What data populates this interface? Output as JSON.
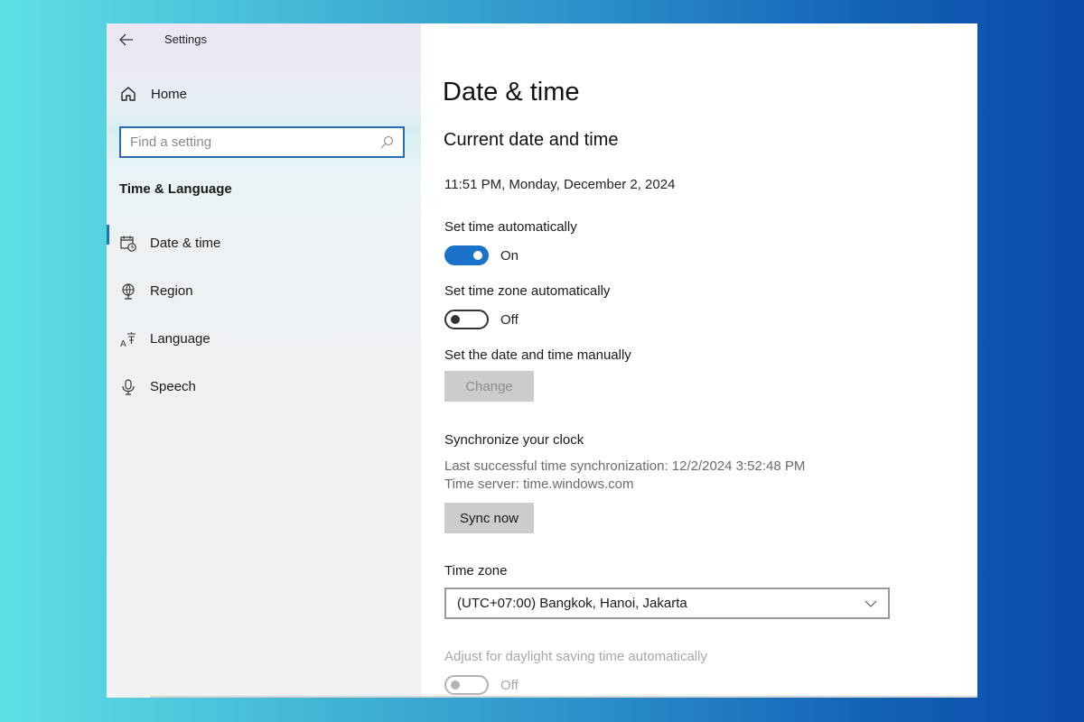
{
  "window": {
    "title": "Settings",
    "back_icon": "arrow-left-icon"
  },
  "sidebar": {
    "home_label": "Home",
    "home_icon": "home-icon",
    "search": {
      "placeholder": "Find a setting",
      "value": "",
      "icon": "search-icon"
    },
    "section_title": "Time & Language",
    "items": [
      {
        "label": "Date & time",
        "icon": "calendar-clock-icon",
        "active": true
      },
      {
        "label": "Region",
        "icon": "globe-icon",
        "active": false
      },
      {
        "label": "Language",
        "icon": "language-icon",
        "active": false
      },
      {
        "label": "Speech",
        "icon": "microphone-icon",
        "active": false
      }
    ]
  },
  "main": {
    "page_title": "Date & time",
    "section_title": "Current date and time",
    "current_datetime": "11:51 PM, Monday, December 2, 2024",
    "set_time_auto": {
      "label": "Set time automatically",
      "state": "On",
      "on": true
    },
    "set_timezone_auto": {
      "label": "Set time zone automatically",
      "state": "Off",
      "on": false
    },
    "manual": {
      "label": "Set the date and time manually",
      "button": "Change",
      "enabled": false
    },
    "sync": {
      "title": "Synchronize your clock",
      "last_sync": "Last successful time synchronization: 12/2/2024 3:52:48 PM",
      "server": "Time server: time.windows.com",
      "button": "Sync now"
    },
    "timezone": {
      "label": "Time zone",
      "selected": "(UTC+07:00) Bangkok, Hanoi, Jakarta"
    },
    "daylight": {
      "label": "Adjust for daylight saving time automatically",
      "state": "Off",
      "on": false,
      "enabled": false
    }
  },
  "colors": {
    "accent": "#1a73c8",
    "background_left": "#5fe0e4",
    "background_right": "#0a4aa8"
  }
}
